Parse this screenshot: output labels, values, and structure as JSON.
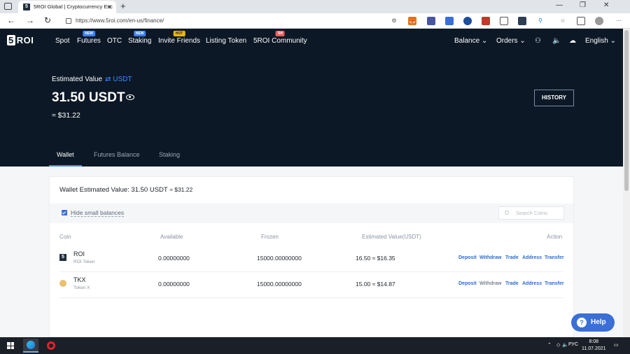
{
  "browser": {
    "tab_title": "5ROI Global | Cryptocurrency Exc",
    "url": "https://www.5roi.com/en-us/finance/",
    "favicon": "5"
  },
  "site": {
    "logo_num": "5",
    "logo_text": "ROI",
    "nav": [
      {
        "label": "Spot",
        "badge": ""
      },
      {
        "label": "Futures",
        "badge": "NEW"
      },
      {
        "label": "OTC",
        "badge": ""
      },
      {
        "label": "Staking",
        "badge": "NEW"
      },
      {
        "label": "Invite Friends",
        "badge": "HOT"
      },
      {
        "label": "Listing Token",
        "badge": ""
      },
      {
        "label": "5ROI Community",
        "badge": "SH"
      }
    ],
    "balance_menu": "Balance",
    "orders_menu": "Orders",
    "language": "English"
  },
  "hero": {
    "estimated_label": "Estimated Value",
    "currency_switch": "USDT",
    "value": "31.50 USDT",
    "approx": "≈ $31.22",
    "history_button": "HISTORY",
    "tabs": [
      "Wallet",
      "Futures Balance",
      "Staking"
    ]
  },
  "wallet": {
    "title": "Wallet Estimated Value: 31.50 USDT",
    "title_approx": "≈ $31.22",
    "hide_small": "Hide small balances",
    "search_placeholder": "Search Coins",
    "columns": [
      "Coin",
      "Available",
      "Frozen",
      "Estimated Value(USDT)",
      "Action"
    ],
    "rows": [
      {
        "symbol": "ROI",
        "name": "ROI Token",
        "available": "0.00000000",
        "frozen": "15000.00000000",
        "estimated": "16.50 ≈ $16.35",
        "icon": "roi-coin-icon",
        "color": "#1f2d3d"
      },
      {
        "symbol": "TKX",
        "name": "Token X",
        "available": "0.00000000",
        "frozen": "15000.00000000",
        "estimated": "15.00 ≈ $14.87",
        "icon": "tkx-coin-icon",
        "color": "#e8c170"
      }
    ],
    "actions": [
      "Deposit",
      "Withdraw",
      "Trade",
      "Address",
      "Transfer"
    ]
  },
  "help": {
    "label": "Help",
    "icon": "?"
  },
  "taskbar": {
    "lang": "РУС",
    "time": "8:08",
    "date": "11.07.2021"
  },
  "colors": {
    "accent": "#3b8cff",
    "header_bg": "#0c1826",
    "link": "#2d6bd4"
  }
}
